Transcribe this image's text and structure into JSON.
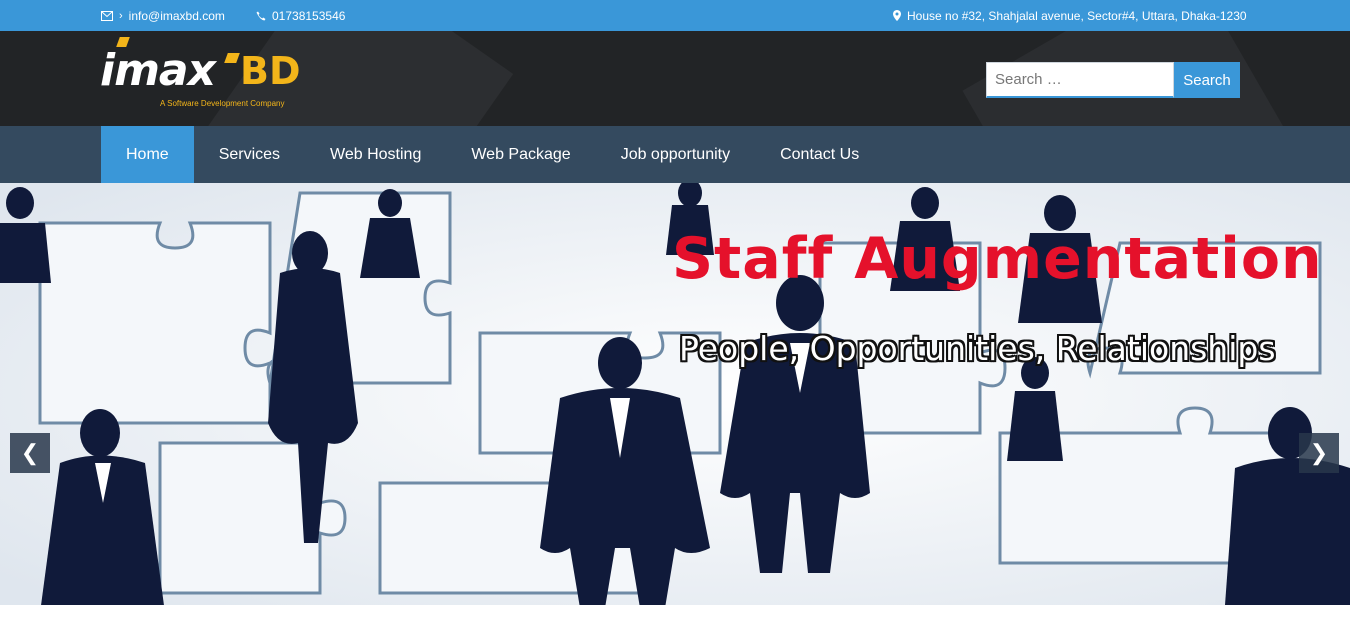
{
  "topbar": {
    "email_icon": "envelope-icon",
    "email": "info@imaxbd.com",
    "phone_icon": "phone-icon",
    "phone": "01738153546",
    "address_icon": "map-marker-icon",
    "address": "House no #32, Shahjalal avenue, Sector#4, Uttara, Dhaka-1230"
  },
  "logo": {
    "main": "imax",
    "accent": "BD",
    "tagline": "A Software Development Company"
  },
  "search": {
    "placeholder": "Search …",
    "button_label": "Search"
  },
  "nav": {
    "items": [
      {
        "label": "Home",
        "active": true
      },
      {
        "label": "Services",
        "active": false
      },
      {
        "label": "Web Hosting",
        "active": false
      },
      {
        "label": "Web Package",
        "active": false
      },
      {
        "label": "Job opportunity",
        "active": false
      },
      {
        "label": "Contact Us",
        "active": false
      }
    ]
  },
  "slider": {
    "headline": "Staff Augmentation",
    "subline": "People, Opportunities, Relationships",
    "prev_icon": "chevron-left-icon",
    "next_icon": "chevron-right-icon"
  },
  "colors": {
    "topbar": "#3a97d8",
    "header": "#222426",
    "nav": "#344a5f",
    "accent": "#3a97d8",
    "logo_yellow": "#f3b51a",
    "headline_red": "#e5112b"
  }
}
